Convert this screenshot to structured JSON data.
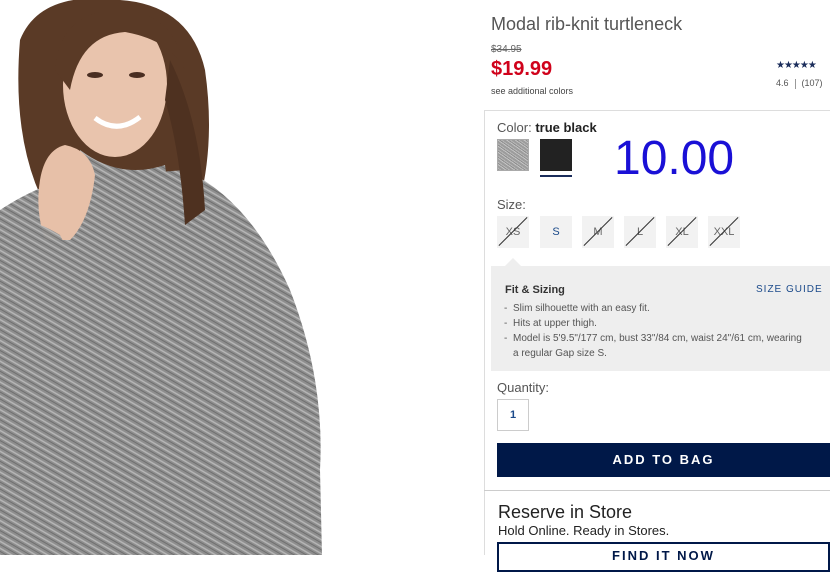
{
  "product": {
    "title": "Modal rib-knit turtleneck",
    "original_price": "$34.95",
    "sale_price": "$19.99",
    "see_colors": "see additional colors",
    "rating_stars": "★★★★★",
    "rating_value": "4.6",
    "review_count": "(107)"
  },
  "color": {
    "label": "Color:",
    "selected": "true black",
    "swatches": [
      "heather-gray",
      "true-black"
    ]
  },
  "overlay_number": "10.00",
  "size": {
    "label": "Size:",
    "options": [
      {
        "label": "XS",
        "available": false
      },
      {
        "label": "S",
        "available": true
      },
      {
        "label": "M",
        "available": false
      },
      {
        "label": "L",
        "available": false
      },
      {
        "label": "XL",
        "available": false
      },
      {
        "label": "XXL",
        "available": false
      }
    ]
  },
  "fit": {
    "title": "Fit & Sizing",
    "size_guide": "SIZE GUIDE",
    "bullets": [
      "Slim silhouette with an easy fit.",
      "Hits at upper thigh.",
      "Model is 5'9.5\"/177 cm, bust 33\"/84 cm, waist 24\"/61 cm, wearing a regular Gap size S."
    ]
  },
  "quantity": {
    "label": "Quantity:",
    "value": "1"
  },
  "add_to_bag": "ADD TO BAG",
  "reserve": {
    "title": "Reserve in Store",
    "subtitle": "Hold Online. Ready in Stores.",
    "button": "FIND IT NOW"
  },
  "colors": {
    "sale": "#d0021b",
    "navy": "#001848",
    "link": "#1b4a8a",
    "overlay": "#1a10d6"
  }
}
